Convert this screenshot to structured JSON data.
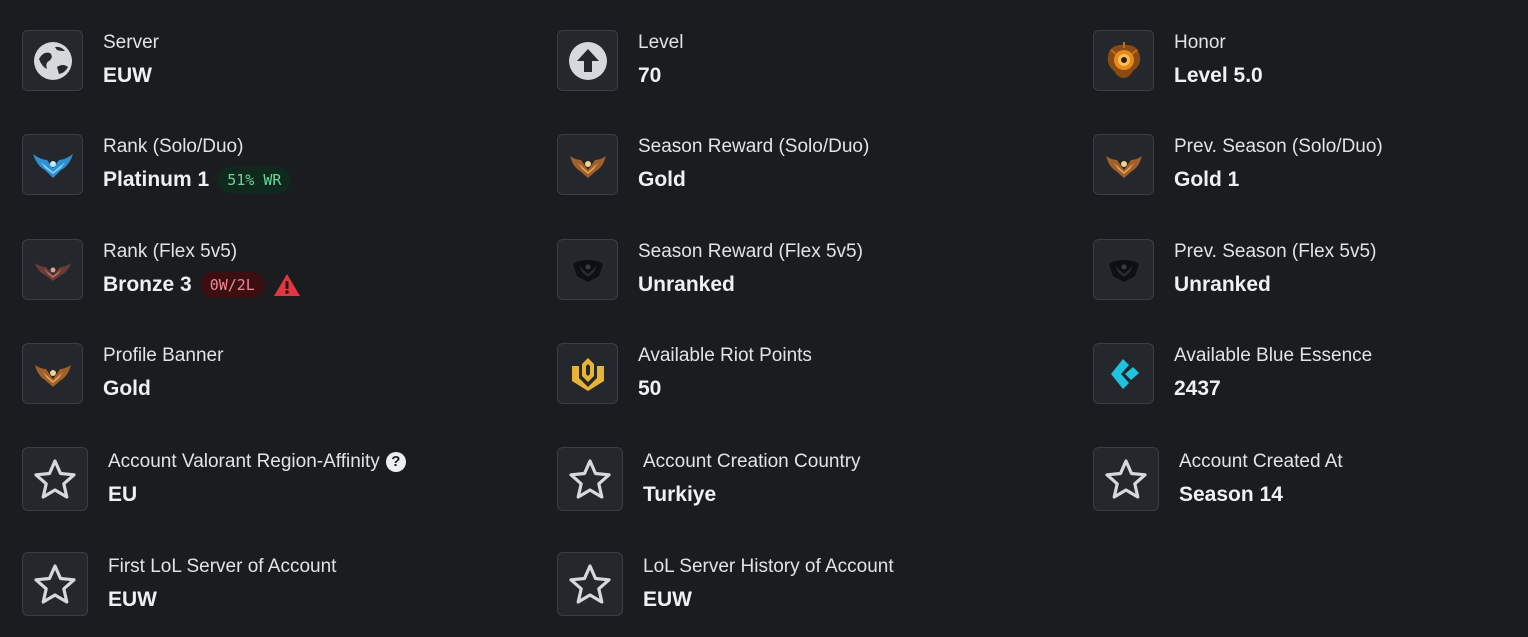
{
  "stats": {
    "server": {
      "label": "Server",
      "value": "EUW",
      "icon": "globe-icon"
    },
    "level": {
      "label": "Level",
      "value": "70",
      "icon": "arrow-up-icon"
    },
    "honor": {
      "label": "Honor",
      "value": "Level 5.0",
      "icon": "honor-icon"
    },
    "rank_solo": {
      "label": "Rank (Solo/Duo)",
      "value": "Platinum 1",
      "badge": "51% WR",
      "icon": "platinum-emblem-icon"
    },
    "season_reward_solo": {
      "label": "Season Reward (Solo/Duo)",
      "value": "Gold",
      "icon": "gold-emblem-icon"
    },
    "prev_season_solo": {
      "label": "Prev. Season (Solo/Duo)",
      "value": "Gold 1",
      "icon": "gold-emblem-icon"
    },
    "rank_flex": {
      "label": "Rank (Flex 5v5)",
      "value": "Bronze 3",
      "badge": "0W/2L",
      "icon": "bronze-emblem-icon"
    },
    "season_reward_flex": {
      "label": "Season Reward (Flex 5v5)",
      "value": "Unranked",
      "icon": "unranked-emblem-icon"
    },
    "prev_season_flex": {
      "label": "Prev. Season (Flex 5v5)",
      "value": "Unranked",
      "icon": "unranked-emblem-icon"
    },
    "profile_banner": {
      "label": "Profile Banner",
      "value": "Gold",
      "icon": "gold-emblem-icon"
    },
    "riot_points": {
      "label": "Available Riot Points",
      "value": "50",
      "icon": "riot-points-icon"
    },
    "blue_essence": {
      "label": "Available Blue Essence",
      "value": "2437",
      "icon": "blue-essence-icon"
    },
    "valorant_region": {
      "label": "Account Valorant Region-Affinity",
      "value": "EU",
      "icon": "star-icon"
    },
    "creation_country": {
      "label": "Account Creation Country",
      "value": "Turkiye",
      "icon": "star-icon"
    },
    "created_at": {
      "label": "Account Created At",
      "value": "Season 14",
      "icon": "star-icon"
    },
    "first_server": {
      "label": "First LoL Server of Account",
      "value": "EUW",
      "icon": "star-icon"
    },
    "server_history": {
      "label": "LoL Server History of Account",
      "value": "EUW",
      "icon": "star-icon"
    }
  },
  "colors": {
    "background": "#1a1c20",
    "icon_border": "#3a3f47",
    "wr_badge_bg": "#0f2a1d",
    "wr_badge_text": "#6fd49a",
    "loss_badge_bg": "#3b0f12",
    "loss_badge_text": "#f08a8f",
    "warning": "#e5353f"
  }
}
